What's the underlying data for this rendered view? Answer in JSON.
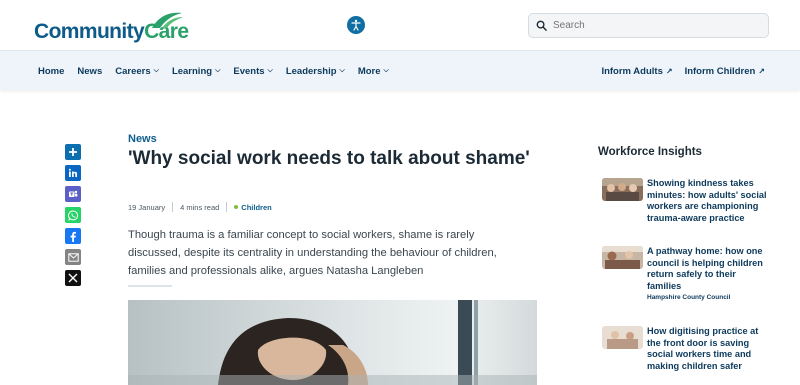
{
  "brand": {
    "logo_part1": "Community",
    "logo_part2": "Care"
  },
  "search": {
    "placeholder": "Search"
  },
  "nav": {
    "left": [
      {
        "label": "Home",
        "dropdown": false
      },
      {
        "label": "News",
        "dropdown": false
      },
      {
        "label": "Careers",
        "dropdown": true
      },
      {
        "label": "Learning",
        "dropdown": true
      },
      {
        "label": "Events",
        "dropdown": true
      },
      {
        "label": "Leadership",
        "dropdown": true
      },
      {
        "label": "More",
        "dropdown": true
      }
    ],
    "right": [
      {
        "label": "Inform Adults",
        "external": true
      },
      {
        "label": "Inform Children",
        "external": true
      }
    ]
  },
  "share": [
    {
      "icon": "plus-share-icon",
      "color": "#0b6fb0"
    },
    {
      "icon": "linkedin-icon",
      "color": "#0a66c2"
    },
    {
      "icon": "teams-icon",
      "color": "#5b5fc7"
    },
    {
      "icon": "whatsapp-icon",
      "color": "#25d366"
    },
    {
      "icon": "facebook-icon",
      "color": "#1877f2"
    },
    {
      "icon": "email-icon",
      "color": "#848484"
    },
    {
      "icon": "x-icon",
      "color": "#111111"
    }
  ],
  "article": {
    "category": "News",
    "title": "'Why social work needs to talk about shame'",
    "date": "19 January",
    "read_time": "4 mins read",
    "tag": "Children",
    "standfirst": "Though trauma is a familiar concept to social workers, shame is rarely discussed, despite its centrality in understanding the behaviour of children, families and professionals alike, argues Natasha Langleben"
  },
  "sidebar": {
    "title": "Workforce Insights",
    "cards": [
      {
        "title": "Showing kindness takes minutes: how adults' social workers are championing trauma-aware practice",
        "sponsor": ""
      },
      {
        "title": "A pathway home: how one council is helping children return safely to their families",
        "sponsor": "Hampshire County Council"
      },
      {
        "title": "How digitising practice at the front door is saving social workers time and making children safer",
        "sponsor": ""
      }
    ]
  },
  "colors": {
    "accent": "#0f5e8e",
    "brand_blue": "#0e5b8a",
    "brand_green": "#2aa16a",
    "nav_bg": "#eef4f9"
  }
}
